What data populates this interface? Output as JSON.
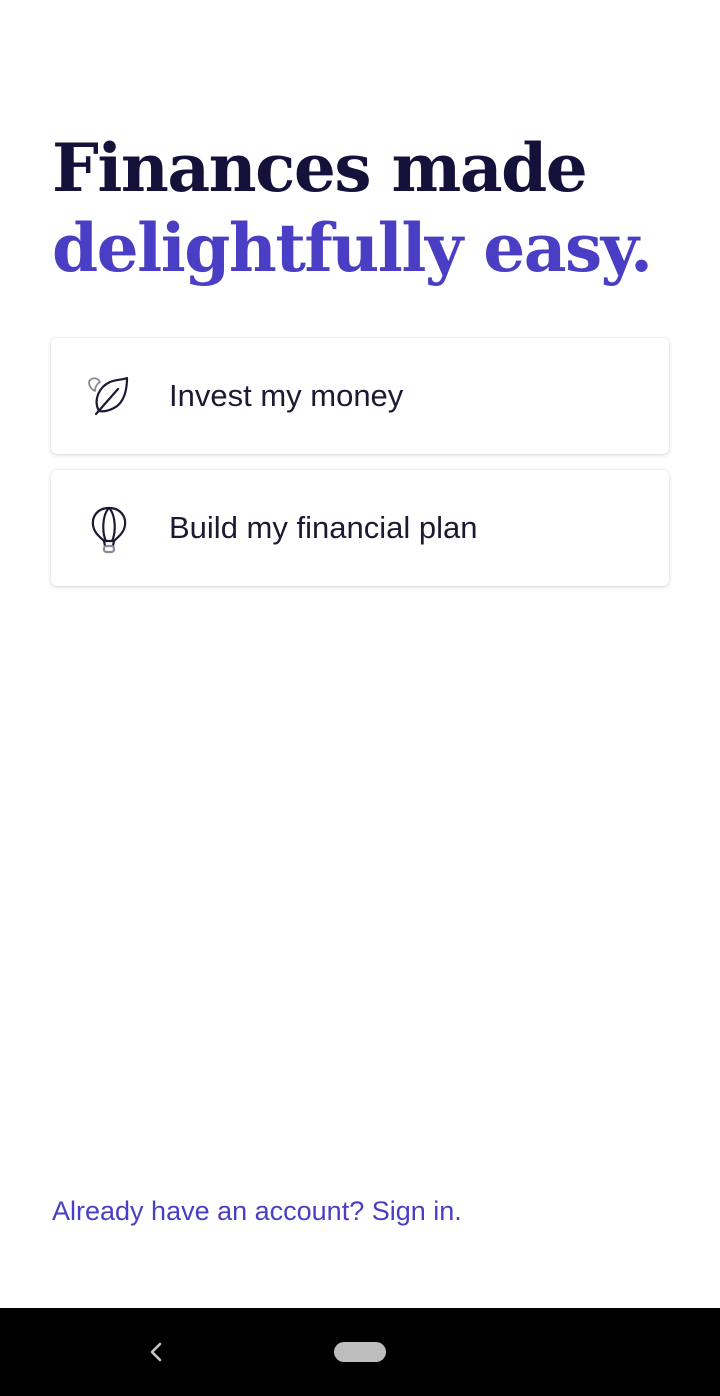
{
  "headline": {
    "line1": "Finances made",
    "line2": "delightfully easy."
  },
  "options": [
    {
      "label": "Invest my money",
      "icon": "leaf-icon"
    },
    {
      "label": "Build my financial plan",
      "icon": "hot-air-balloon-icon"
    }
  ],
  "signin": {
    "text": "Already have an account? Sign in."
  },
  "navigation": {
    "back_icon": "back-chevron-icon",
    "home_icon": "home-pill"
  },
  "colors": {
    "headline_dark": "#14123a",
    "accent": "#4a3fc4",
    "text": "#1c1a33",
    "nav_bar": "#000000"
  }
}
